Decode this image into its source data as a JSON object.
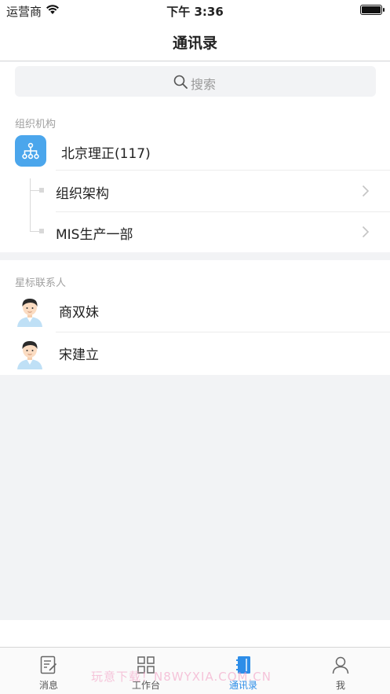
{
  "status_bar": {
    "carrier": "运营商",
    "time": "下午 3:36"
  },
  "nav": {
    "title": "通讯录"
  },
  "search": {
    "placeholder": "搜索"
  },
  "org": {
    "section_title": "组织机构",
    "root_label": "北京理正(117)",
    "children": [
      {
        "label": "组织架构"
      },
      {
        "label": "MIS生产一部"
      }
    ]
  },
  "starred": {
    "section_title": "星标联系人",
    "contacts": [
      {
        "name": "商双妹"
      },
      {
        "name": "宋建立"
      }
    ]
  },
  "tabs": [
    {
      "label": "消息",
      "icon": "message-icon"
    },
    {
      "label": "工作台",
      "icon": "grid-icon"
    },
    {
      "label": "通讯录",
      "icon": "contacts-book-icon",
      "active": true
    },
    {
      "label": "我",
      "icon": "person-icon"
    }
  ],
  "watermark": "玩意下载！N8WYXIA.COM.CN",
  "colors": {
    "accent": "#2d8de8",
    "org_badge": "#4ba6ec",
    "background": "#f2f3f5"
  }
}
